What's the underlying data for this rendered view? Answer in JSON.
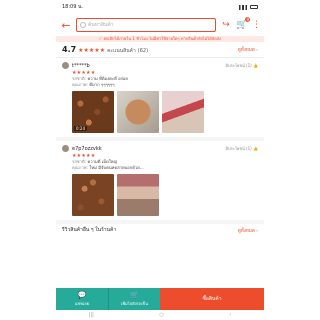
{
  "status": {
    "time": "18:09 น."
  },
  "search": {
    "placeholder": "ค้นหาสินค้า"
  },
  "cart": {
    "badge": "9"
  },
  "promo": {
    "text": "✓ ยกเลิกได้ภายใน 1 ชั่วโมง ไม่มีค่าใช้จ่ายใดๆ หากสินค้ายังไม่ได้จัดส่ง"
  },
  "rating_summary": {
    "score": "4.7",
    "stars": "★★★★★",
    "label": "คะแนนสินค้า",
    "count": "(62)",
    "see_all": "ดูทั้งหมด ›"
  },
  "reviews": [
    {
      "user": "t*****b",
      "helpful": "มีประโยชน์ (1) 👍",
      "stars": "★★★★★",
      "variant_label": "รสชาติ:",
      "variant": "ความ ที่ต้องตะดี อร่อย",
      "quality_label": "คุณภาพ:",
      "quality": "ดีมาก ๆๆๆๆๆๆ",
      "video_time": "0:24"
    },
    {
      "user": "e7p7ozzvkk",
      "helpful": "มีประโยชน์ (1) 👍",
      "stars": "★★★★★",
      "variant_label": "รสชาติ:",
      "variant": "ความดี เม็ดใหญ่",
      "quality_label": "คุณภาพ:",
      "quality": "ใหม่ มีจับตนทดสายบอกด้วย..."
    }
  ],
  "more": {
    "title": "รีวิวสินค้าอื่น ๆ ในร้านค้า",
    "see_all": "ดูทั้งหมด ›"
  },
  "bottom": {
    "chat": "แชทเลย",
    "add_cart": "เพิ่มไปยังรถเข็น",
    "buy": "ซื้อสินค้า"
  },
  "colors": {
    "accent": "#ee4d2d",
    "teal": "#26aa99"
  }
}
